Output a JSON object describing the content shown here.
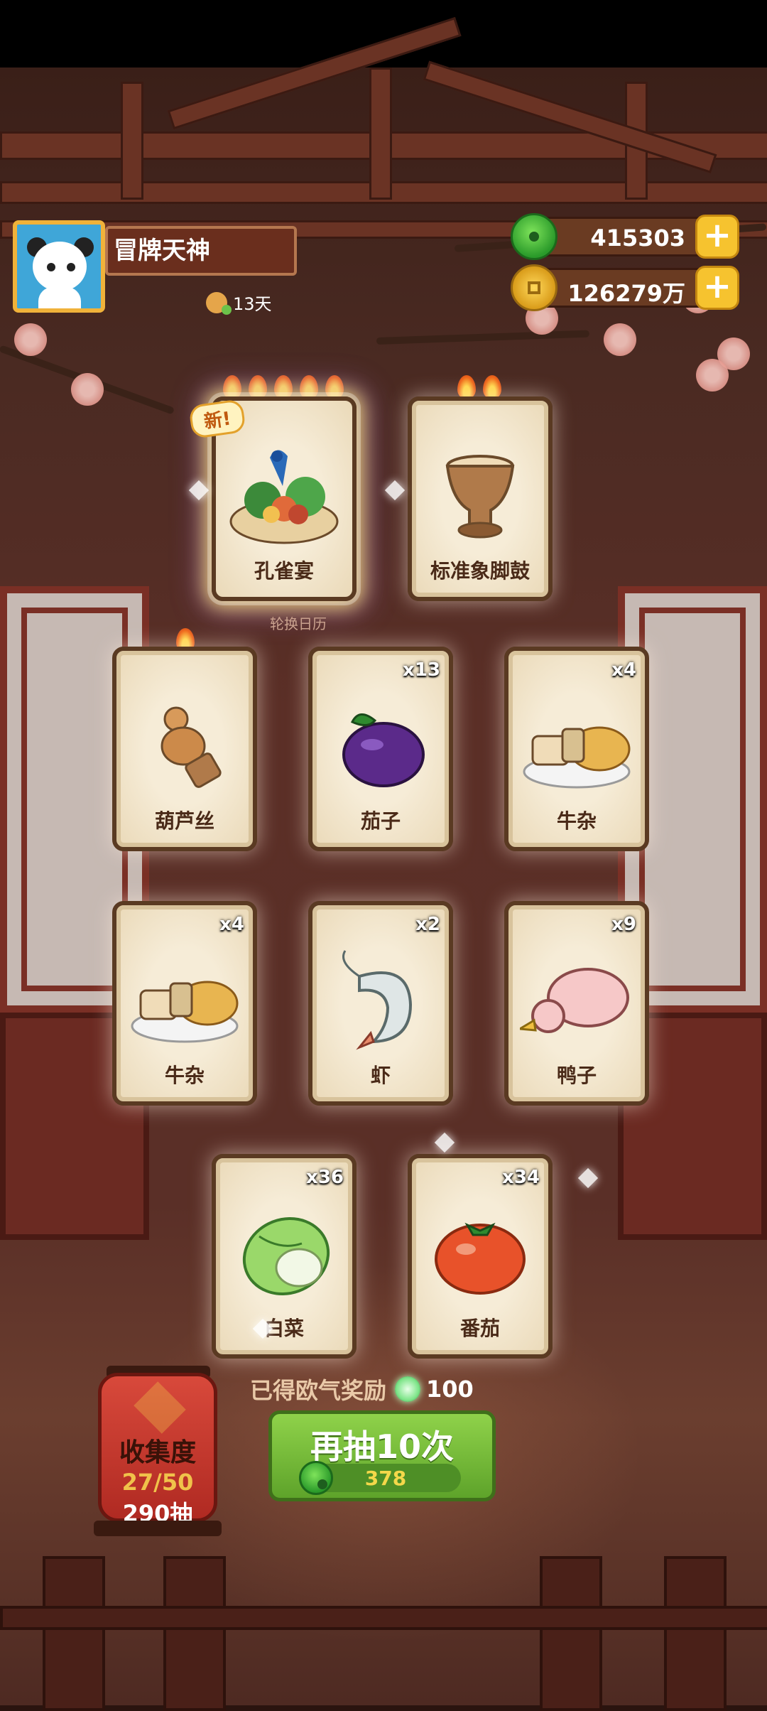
{
  "player": {
    "name": "冒牌天神",
    "days": "13天"
  },
  "currency": {
    "jade": "415303",
    "gold": "126279万"
  },
  "featured_cards": [
    {
      "name": "孔雀宴",
      "tag": "新!",
      "fires": 5
    },
    {
      "name": "标准象脚鼓",
      "fires": 2
    }
  ],
  "calendar_note": "轮换日历",
  "cards": [
    {
      "name": "葫芦丝",
      "count": ""
    },
    {
      "name": "茄子",
      "count": "x13"
    },
    {
      "name": "牛杂",
      "count": "x4"
    },
    {
      "name": "牛杂",
      "count": "x4"
    },
    {
      "name": "虾",
      "count": "x2"
    },
    {
      "name": "鸭子",
      "count": "x9"
    },
    {
      "name": "白菜",
      "count": "x36"
    },
    {
      "name": "番茄",
      "count": "x34"
    }
  ],
  "collection": {
    "label": "收集度",
    "progress": "27/50",
    "draws": "290抽"
  },
  "reward": {
    "label": "已得欧气奖励",
    "value": "100"
  },
  "draw_button": {
    "label": "再抽10次",
    "cost": "378"
  }
}
